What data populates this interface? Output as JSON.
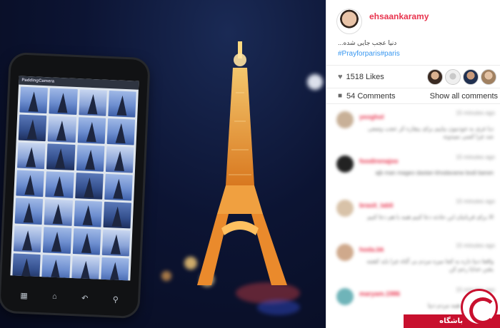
{
  "post": {
    "username": "ehsaankaramy",
    "caption": "دنیا عجب جایی شده...",
    "hashtags": "#Prayforparis#paris",
    "likes": "1518 Likes",
    "comments_count": "54 Comments",
    "show_all": "Show all comments"
  },
  "photo": {
    "phone_app_title": "PaddingCamera",
    "phone_nav_icons": [
      "grid-icon",
      "home-icon",
      "back-icon",
      "search-icon"
    ]
  },
  "comments": [
    {
      "user": "yeoghol",
      "time": "15 minutes ago",
      "text": "دیا غزی به خودمون بیاییم برای بیچاره کر عجب وضعی شد چرا کسی نمیدونه"
    },
    {
      "user": "foodirenajoo",
      "time": "15 minutes ago",
      "text": "ajb man mageo dastan khodavanw bodi barwn"
    },
    {
      "user": "brasit_labli",
      "time": "15 minutes ago",
      "text": "الا برای قربانیان این حادثه دعا کنیم همه با هم دعا کنیم"
    },
    {
      "user": "hoda.bk",
      "time": "15 minutes ago",
      "text": "واقعا دنیا داره به کجا میره مردم بی گناه چرا باید کشته بشن خدایا رحم کن"
    },
    {
      "user": "maryam.1986",
      "time": "15 minutes ago",
      "text": "دعا کنیم برای همه مردم دنیا"
    }
  ],
  "watermark": {
    "text": "باشگاه خبرنگاران"
  },
  "colors": {
    "accent": "#e8344e",
    "link": "#3897f0",
    "watermark": "#c8102e"
  }
}
